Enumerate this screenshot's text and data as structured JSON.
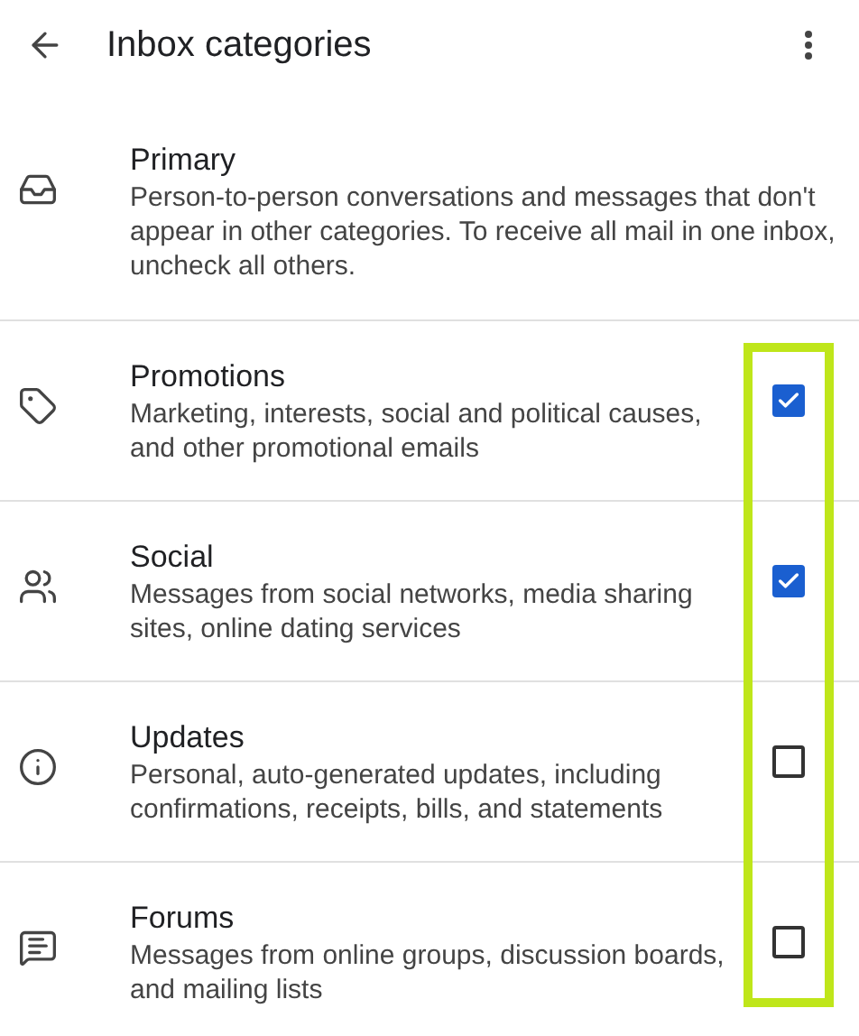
{
  "header": {
    "title": "Inbox categories"
  },
  "categories": [
    {
      "kind": "info",
      "title": "Primary",
      "description": "Person-to-person conversations and messages that don't appear in other categories. To receive all mail in one inbox, uncheck all others."
    },
    {
      "kind": "checkbox",
      "title": "Promotions",
      "description": "Marketing, interests, social and political causes, and other promotional emails",
      "checked": true
    },
    {
      "kind": "checkbox",
      "title": "Social",
      "description": "Messages from social networks, media sharing sites, online dating services",
      "checked": true
    },
    {
      "kind": "checkbox",
      "title": "Updates",
      "description": "Personal, auto-generated updates, including confirmations, receipts, bills, and statements",
      "checked": false
    },
    {
      "kind": "checkbox",
      "title": "Forums",
      "description": "Messages from online groups, discussion boards, and mailing lists",
      "checked": false
    }
  ]
}
